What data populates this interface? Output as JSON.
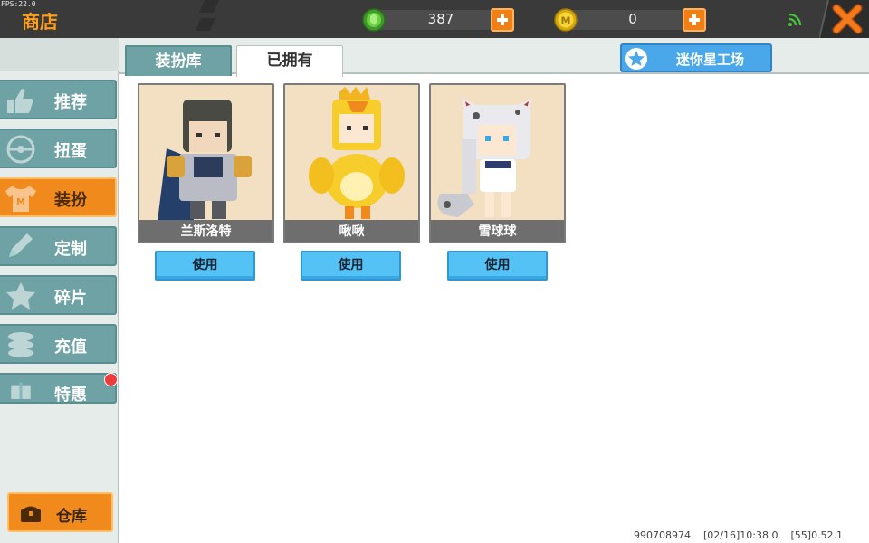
{
  "debug": {
    "fps": "FPS:22.0"
  },
  "header": {
    "title": "商店",
    "currencies": [
      {
        "name": "mini-bean",
        "icon": "green-gem-icon",
        "value": "387",
        "color": "#5dbb3a"
      },
      {
        "name": "mini-coin",
        "icon": "gold-coin-icon",
        "value": "0",
        "color": "#e8c21a"
      }
    ],
    "signal_icon": "wifi-icon",
    "close_icon": "close-icon"
  },
  "sidebar": {
    "items": [
      {
        "label": "推荐",
        "icon": "thumbs-up-icon",
        "active": false
      },
      {
        "label": "扭蛋",
        "icon": "capsule-icon",
        "active": false
      },
      {
        "label": "装扮",
        "icon": "shirt-icon",
        "active": true
      },
      {
        "label": "定制",
        "icon": "pencil-icon",
        "active": false
      },
      {
        "label": "碎片",
        "icon": "fragment-icon",
        "active": false
      },
      {
        "label": "充值",
        "icon": "coins-icon",
        "active": false
      },
      {
        "label": "特惠",
        "icon": "gift-icon",
        "active": false,
        "badge": true
      }
    ],
    "warehouse_label": "仓库"
  },
  "tabs": [
    {
      "label": "装扮库",
      "active": false
    },
    {
      "label": "已拥有",
      "active": true
    }
  ],
  "workshop": {
    "label": "迷你星工场",
    "icon": "star-icon"
  },
  "skins": [
    {
      "name": "兰斯洛特",
      "button": "使用"
    },
    {
      "name": "啾啾",
      "button": "使用"
    },
    {
      "name": "雪球球",
      "button": "使用"
    }
  ],
  "status_bar": {
    "uid": "990708974",
    "time": "[02/16]10:38 0",
    "version": "[55]0.52.1"
  },
  "colors": {
    "accent_orange": "#f08a1c",
    "sidebar_teal": "#6fa2a4",
    "use_button_blue": "#55c2f5",
    "badge_red": "#ee3b3b"
  }
}
